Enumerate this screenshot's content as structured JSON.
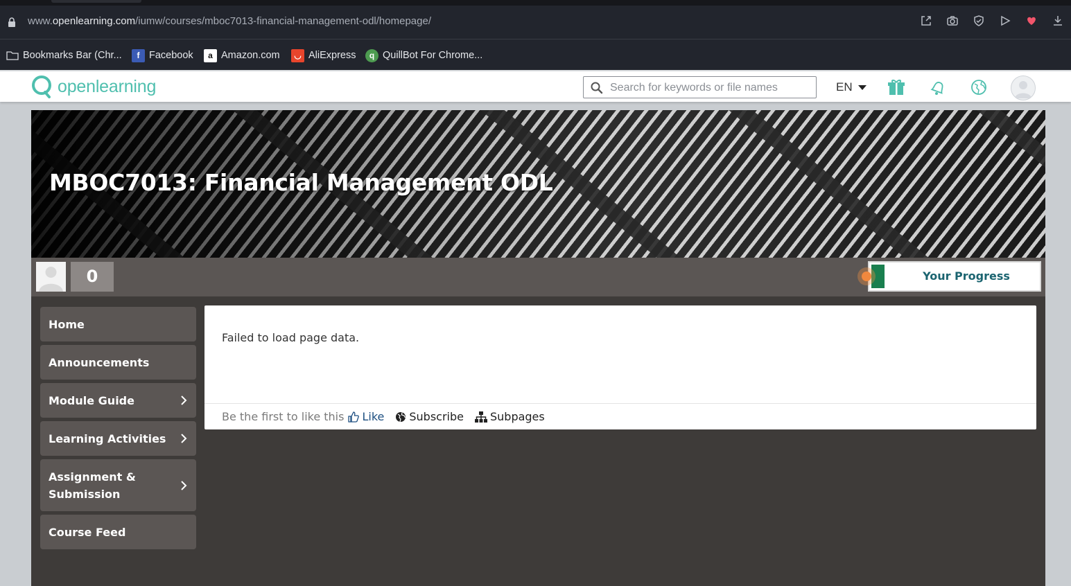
{
  "browser": {
    "url_prefix": "www.",
    "url_domain": "openlearning.com",
    "url_path": "/iumw/courses/mboc7013-financial-management-odl/homepage/",
    "bookmarks": [
      {
        "label": "Bookmarks Bar (Chr...",
        "icon": "folder-icon"
      },
      {
        "label": "Facebook",
        "icon": "facebook-icon"
      },
      {
        "label": "Amazon.com",
        "icon": "amazon-icon"
      },
      {
        "label": "AliExpress",
        "icon": "aliexpress-icon"
      },
      {
        "label": "QuillBot For Chrome...",
        "icon": "quillbot-icon"
      }
    ]
  },
  "header": {
    "logo_text": "openlearning",
    "search_placeholder": "Search for keywords or file names",
    "language": "EN",
    "brand_color": "#4fbfae"
  },
  "course": {
    "title": "MBOC7013: Financial Management ODL",
    "user_count": "0",
    "progress_label": "Your Progress"
  },
  "sidebar": {
    "items": [
      {
        "label": "Home",
        "has_submenu": false
      },
      {
        "label": "Announcements",
        "has_submenu": false
      },
      {
        "label": "Module Guide",
        "has_submenu": true
      },
      {
        "label": "Learning Activities",
        "has_submenu": true
      },
      {
        "label": "Assignment & Submission",
        "has_submenu": true
      },
      {
        "label": "Course Feed",
        "has_submenu": false
      }
    ]
  },
  "content": {
    "message": "Failed to load page data.",
    "like_prompt": "Be the first to like this",
    "like_label": "Like",
    "subscribe_label": "Subscribe",
    "subpages_label": "Subpages"
  }
}
